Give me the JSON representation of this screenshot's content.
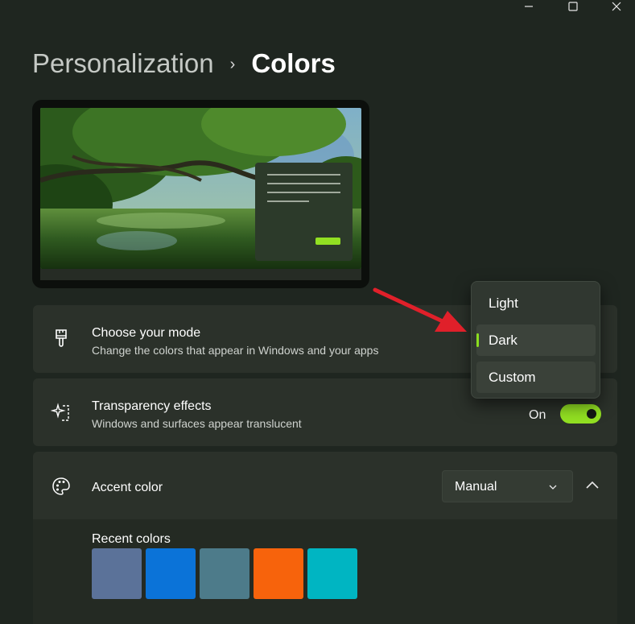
{
  "window": {
    "minimize_icon": "minimize-icon",
    "maximize_icon": "maximize-icon",
    "close_icon": "close-icon"
  },
  "breadcrumb": {
    "parent": "Personalization",
    "separator": "›",
    "current": "Colors"
  },
  "settings": {
    "mode": {
      "title": "Choose your mode",
      "subtitle": "Change the colors that appear in Windows and your apps",
      "icon": "paintbrush-icon"
    },
    "transparency": {
      "title": "Transparency effects",
      "subtitle": "Windows and surfaces appear translucent",
      "toggle_label": "On",
      "toggle_state": true,
      "icon": "transparency-sparkle-icon"
    },
    "accent": {
      "title": "Accent color",
      "select_value": "Manual",
      "icon": "palette-icon",
      "recent_label": "Recent colors",
      "recent_colors": [
        "#5b7299",
        "#0b73d8",
        "#4d7b8a",
        "#f7630c",
        "#00b5c2"
      ]
    }
  },
  "mode_menu": {
    "items": [
      "Light",
      "Dark",
      "Custom"
    ],
    "selected_index": 1
  },
  "colors": {
    "accent": "#92e022",
    "background": "#1f2620",
    "card": "#2b312a",
    "annotation_arrow": "#e0202a"
  }
}
